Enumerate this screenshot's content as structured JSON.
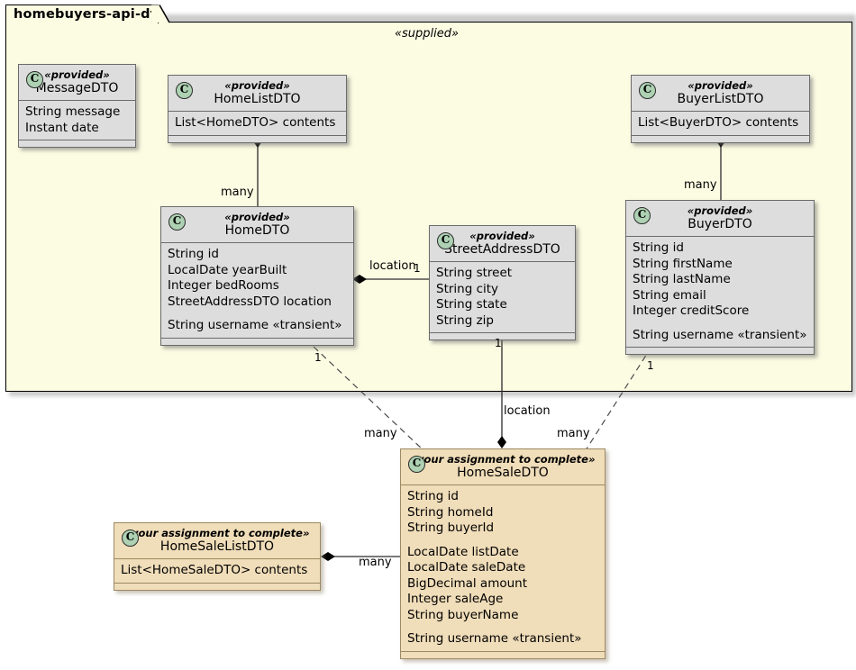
{
  "diagram": {
    "type": "uml-class-diagram",
    "package": {
      "name": "homebuyers-api-dto",
      "stereotype": "«supplied»",
      "background": "#fcfce3"
    },
    "colors": {
      "provided_fill": "#dddddd",
      "assignment_fill": "#f0ddb9",
      "icon_fill": "#ADD1B2",
      "border": "#6b6b6b",
      "package_fill": "#fcfce3"
    },
    "class_icon_letter": "C"
  },
  "classes": [
    {
      "id": "MessageDTO",
      "stereotype": "«provided»",
      "name": "MessageDTO",
      "kind": "provided",
      "attributes": [
        "String message",
        "Instant date"
      ]
    },
    {
      "id": "HomeListDTO",
      "stereotype": "«provided»",
      "name": "HomeListDTO",
      "kind": "provided",
      "attributes": [
        "List<HomeDTO> contents"
      ]
    },
    {
      "id": "BuyerListDTO",
      "stereotype": "«provided»",
      "name": "BuyerListDTO",
      "kind": "provided",
      "attributes": [
        "List<BuyerDTO> contents"
      ]
    },
    {
      "id": "HomeDTO",
      "stereotype": "«provided»",
      "name": "HomeDTO",
      "kind": "provided",
      "attributes": [
        "String id",
        "LocalDate yearBuilt",
        "Integer bedRooms",
        "StreetAddressDTO location",
        "",
        "String username «transient»"
      ]
    },
    {
      "id": "StreetAddressDTO",
      "stereotype": "«provided»",
      "name": "StreetAddressDTO",
      "kind": "provided",
      "attributes": [
        "String street",
        "String city",
        "String state",
        "String zip"
      ]
    },
    {
      "id": "BuyerDTO",
      "stereotype": "«provided»",
      "name": "BuyerDTO",
      "kind": "provided",
      "attributes": [
        "String id",
        "String firstName",
        "String lastName",
        "String email",
        "Integer creditScore",
        "",
        "String username «transient»"
      ]
    },
    {
      "id": "HomeSaleDTO",
      "stereotype": "«your assignment to complete»",
      "name": "HomeSaleDTO",
      "kind": "assignment",
      "attributes": [
        "String id",
        "String homeId",
        "String buyerId",
        "",
        "LocalDate listDate",
        "LocalDate saleDate",
        "BigDecimal amount",
        "Integer saleAge",
        "String buyerName",
        "",
        "String username «transient»"
      ]
    },
    {
      "id": "HomeSaleListDTO",
      "stereotype": "«your assignment to complete»",
      "name": "HomeSaleListDTO",
      "kind": "assignment",
      "attributes": [
        "List<HomeSaleDTO> contents"
      ]
    }
  ],
  "edge_labels": {
    "homelist_many": "many",
    "buyerlist_many": "many",
    "home_location": "location",
    "home_location_mult": "1",
    "home_sale_mult": "1",
    "home_sale_many": "many",
    "address_sale_mult": "1",
    "address_sale_location": "location",
    "buyer_sale_mult": "1",
    "buyer_sale_many": "many",
    "salelist_many": "many"
  }
}
